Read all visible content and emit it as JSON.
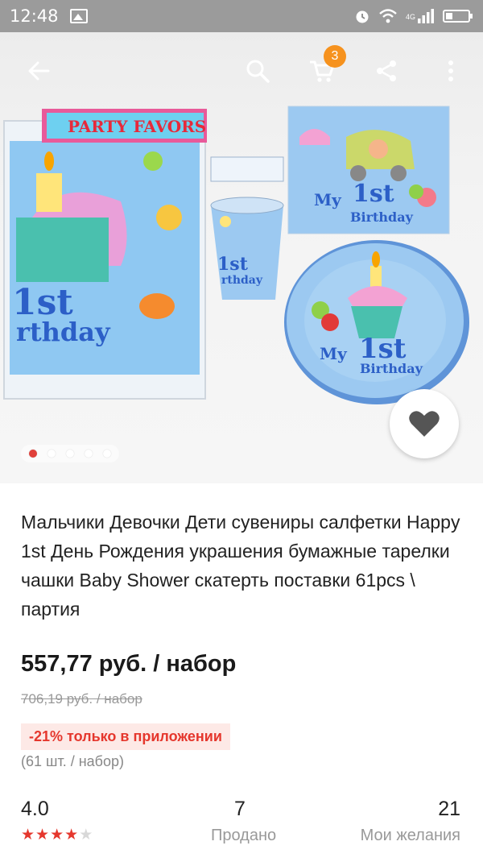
{
  "status_bar": {
    "time": "12:48",
    "network": "4G"
  },
  "toolbar": {
    "cart_count": "3"
  },
  "gallery": {
    "image_count": 5,
    "active_index": 0,
    "product_texts": {
      "package_label": "PARTY FAVORS",
      "tablecloth_number": "1st",
      "tablecloth_word": "rthday",
      "napkin_my": "My",
      "napkin_number": "1st",
      "napkin_word": "Birthday",
      "plate_my": "My",
      "plate_number": "1st",
      "plate_word": "Birthday",
      "cup_number": "1st",
      "cup_word": "rthday"
    }
  },
  "product": {
    "title": "Мальчики Девочки Дети сувениры салфетки Happy 1st День Рождения украшения бумажные тарелки чашки Baby Shower скатерть поставки 61pcs \\ партия",
    "price": "557,77 руб. / набор",
    "old_price": "706,19 руб. / набор",
    "promo": "-21% только в приложении",
    "pack_info": "(61 шт. / набор)"
  },
  "stats": {
    "rating": "4.0",
    "rating_stars": 4,
    "sold_count": "7",
    "sold_label": "Продано",
    "wishlist_count": "21",
    "wishlist_label": "Мои желания"
  },
  "colors": {
    "accent": "#e5372d",
    "badge": "#f6921e",
    "product_blue": "#8ec5f0"
  }
}
